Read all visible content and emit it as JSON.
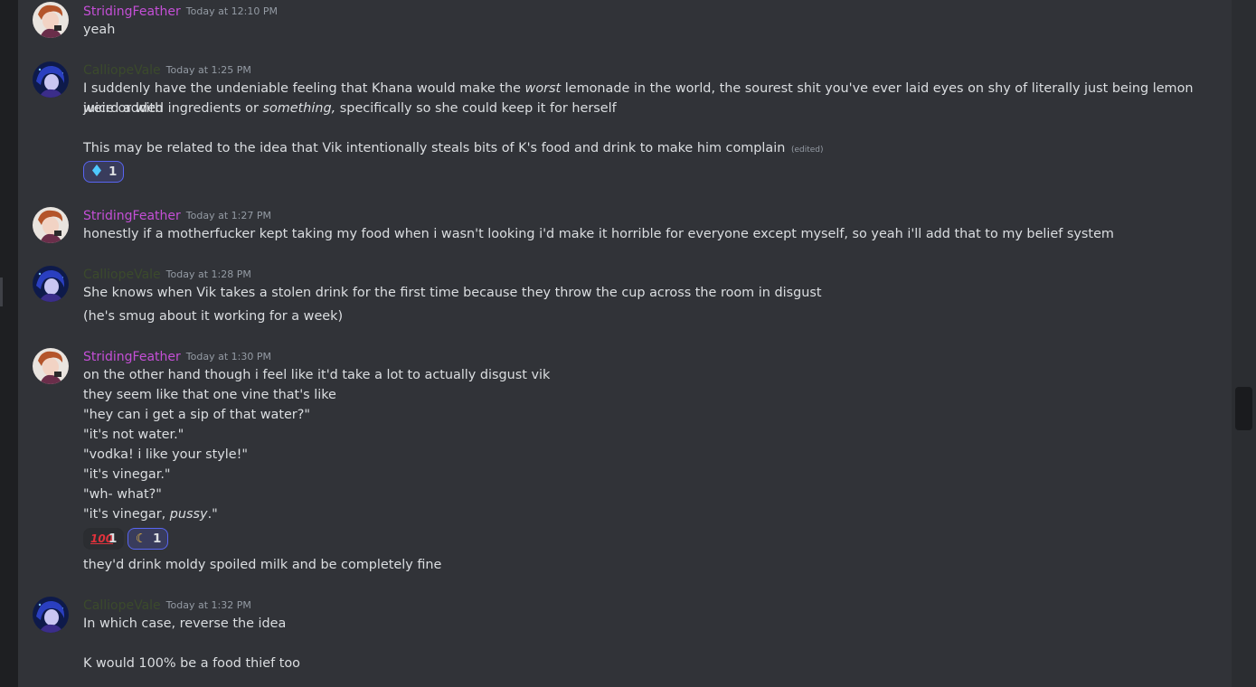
{
  "messages": [
    {
      "author": "StridingFeather",
      "timestamp": "Today at 12:10 PM",
      "lines": [
        "yeah"
      ]
    },
    {
      "author": "CalliopeVale",
      "timestamp": "Today at 1:25 PM",
      "lines": [
        {
          "a": "I suddenly have the undeniable feeling that Khana would make the ",
          "b": "worst",
          "c": " lemonade in the world, the sourest shit you've ever laid eyes on shy of literally just being lemon juice or with"
        },
        {
          "a": "weird added ingredients or ",
          "b": "something,",
          "c": " specifically so she could keep it for herself"
        },
        "This may be related to the idea that Vik intentionally steals bits of K's food and drink to make him complain"
      ],
      "edited_label": "(edited)",
      "reactions": [
        {
          "emoji": "diamond-emoji",
          "count": "1",
          "color": "#4ec9ff"
        }
      ]
    },
    {
      "author": "StridingFeather",
      "timestamp": "Today at 1:27 PM",
      "lines": [
        "honestly if a motherfucker kept taking my food when i wasn't looking i'd make it horrible for everyone except myself, so yeah i'll add that to my belief system"
      ]
    },
    {
      "author": "CalliopeVale",
      "timestamp": "Today at 1:28 PM",
      "lines": [
        "She knows when Vik takes a stolen drink for the first time because they throw the cup across the room in disgust",
        "(he's smug about it working for a week)"
      ]
    },
    {
      "author": "StridingFeather",
      "timestamp": "Today at 1:30 PM",
      "lines": [
        "on the other hand though i feel like it'd take a lot to actually disgust vik",
        "they seem like that one vine that's like",
        "\"hey can i get a sip of that water?\"",
        "\"it's not water.\"",
        "\"vodka! i like your style!\"",
        "\"it's vinegar.\"",
        "\"wh- what?\"",
        {
          "a": "\"it's vinegar, ",
          "b": "pussy",
          "c": ".\""
        },
        "they'd drink moldy spoiled milk and be completely fine"
      ],
      "reactions": [
        {
          "emoji": "hundred-points-emoji",
          "glyph": "💯",
          "count": "1",
          "color": "#e0323c"
        },
        {
          "emoji": "crescent-moon-emoji",
          "glyph": "☾",
          "count": "1",
          "color": "#f6c342"
        }
      ]
    },
    {
      "author": "CalliopeVale",
      "timestamp": "Today at 1:32 PM",
      "lines": [
        "In which case, reverse the idea",
        "K would 100% be a food thief too"
      ]
    }
  ],
  "colors": {
    "chat_bg": "#313338",
    "text": "#dbdee1",
    "timestamp": "#949ba4",
    "striding_feather": "#c44fd6",
    "calliope_vale": "#3b4a2c",
    "reaction_border": "#5865f2"
  }
}
